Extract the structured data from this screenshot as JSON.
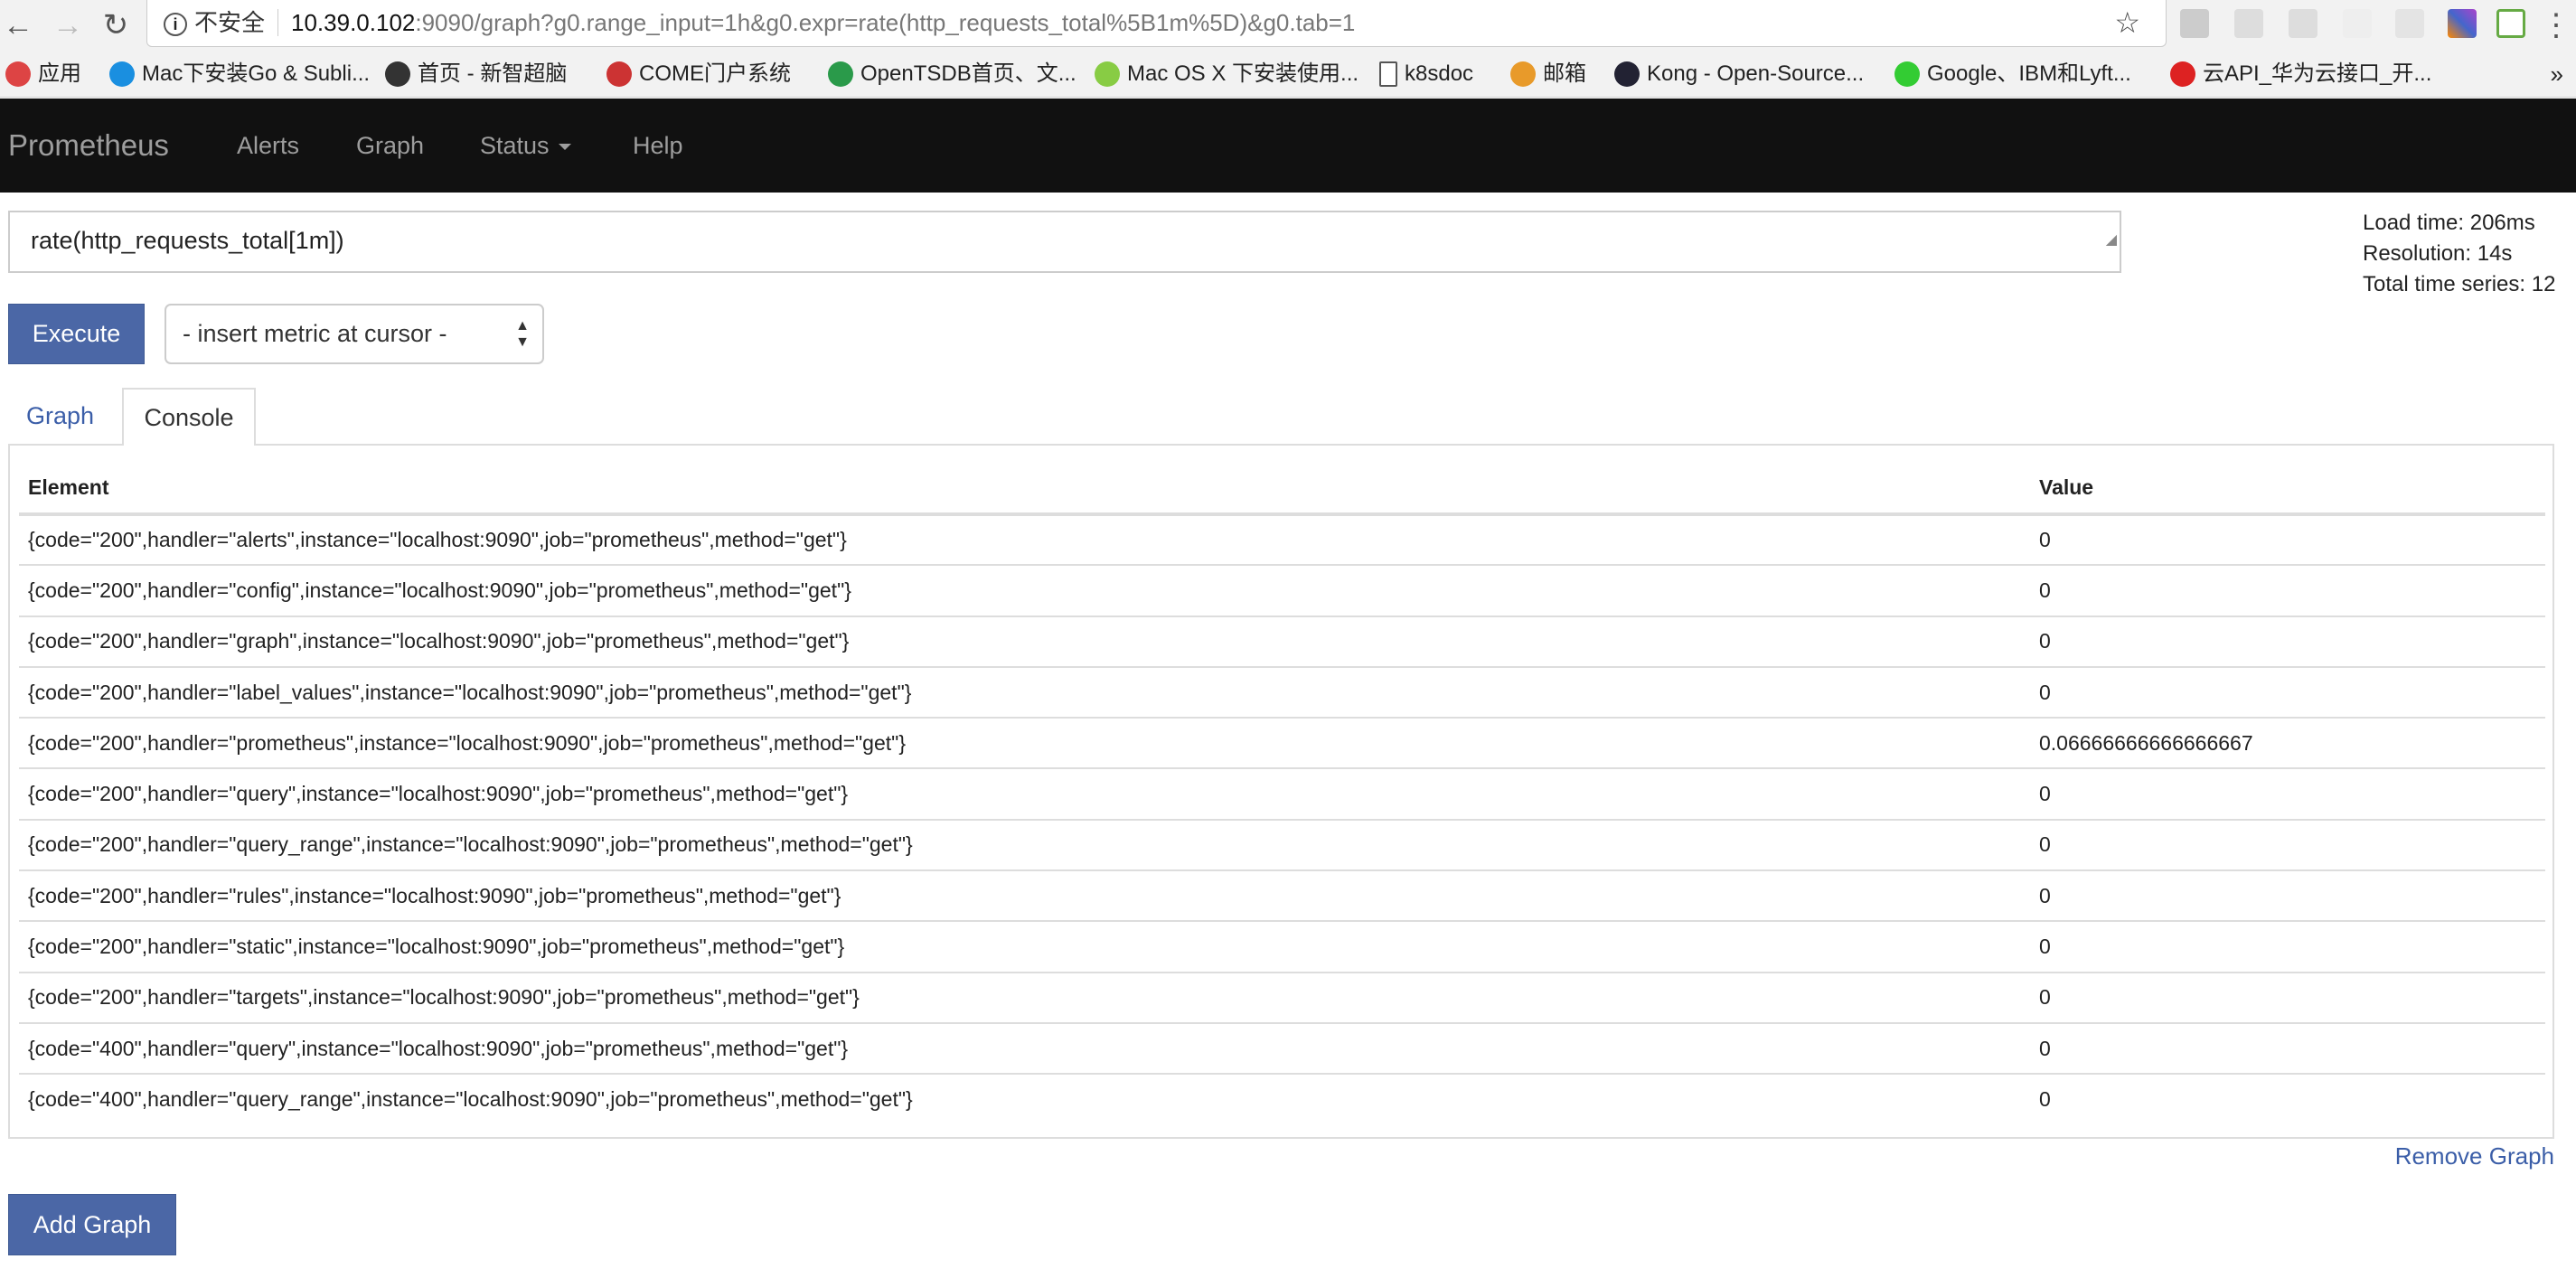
{
  "browser": {
    "security_label": "不安全",
    "url_host": "10.39.0.102",
    "url_path": ":9090/graph?g0.range_input=1h&g0.expr=rate(http_requests_total%5B1m%5D)&g0.tab=1",
    "bookmarks": [
      {
        "label": "应用",
        "icon": "apps-grid-icon",
        "color": "#d44"
      },
      {
        "label": "Mac下安装Go & Subli...",
        "icon": "c-logo-icon",
        "color": "#1a8fe0"
      },
      {
        "label": "首页 - 新智超脑",
        "icon": "edit-icon",
        "color": "#333"
      },
      {
        "label": "COME门户系统",
        "icon": "come-logo-icon",
        "color": "#c33"
      },
      {
        "label": "OpenTSDB首页、文...",
        "icon": "opentsdb-icon",
        "color": "#2a9a4a"
      },
      {
        "label": "Mac OS X 下安装使用...",
        "icon": "notepad-icon",
        "color": "#8c4"
      },
      {
        "label": "k8sdoc",
        "icon": "document-icon",
        "color": "#fff"
      },
      {
        "label": "邮箱",
        "icon": "mail-icon",
        "color": "#e89a2a"
      },
      {
        "label": "Kong - Open-Source...",
        "icon": "kong-gorilla-icon",
        "color": "#223"
      },
      {
        "label": "Google、IBM和Lyft...",
        "icon": "wechat-icon",
        "color": "#3c3"
      },
      {
        "label": "云API_华为云接口_开...",
        "icon": "huawei-icon",
        "color": "#d22"
      }
    ]
  },
  "navbar": {
    "brand": "Prometheus",
    "links": [
      "Alerts",
      "Graph",
      "Status",
      "Help"
    ]
  },
  "query": {
    "expression": "rate(http_requests_total[1m])",
    "execute_label": "Execute",
    "metric_select": "- insert metric at cursor -"
  },
  "stats": {
    "load_time": "Load time: 206ms",
    "resolution": "Resolution: 14s",
    "total_series": "Total time series: 12"
  },
  "tabs": [
    "Graph",
    "Console"
  ],
  "table": {
    "headers": [
      "Element",
      "Value"
    ],
    "rows": [
      [
        "{code=\"200\",handler=\"alerts\",instance=\"localhost:9090\",job=\"prometheus\",method=\"get\"}",
        "0"
      ],
      [
        "{code=\"200\",handler=\"config\",instance=\"localhost:9090\",job=\"prometheus\",method=\"get\"}",
        "0"
      ],
      [
        "{code=\"200\",handler=\"graph\",instance=\"localhost:9090\",job=\"prometheus\",method=\"get\"}",
        "0"
      ],
      [
        "{code=\"200\",handler=\"label_values\",instance=\"localhost:9090\",job=\"prometheus\",method=\"get\"}",
        "0"
      ],
      [
        "{code=\"200\",handler=\"prometheus\",instance=\"localhost:9090\",job=\"prometheus\",method=\"get\"}",
        "0.06666666666666667"
      ],
      [
        "{code=\"200\",handler=\"query\",instance=\"localhost:9090\",job=\"prometheus\",method=\"get\"}",
        "0"
      ],
      [
        "{code=\"200\",handler=\"query_range\",instance=\"localhost:9090\",job=\"prometheus\",method=\"get\"}",
        "0"
      ],
      [
        "{code=\"200\",handler=\"rules\",instance=\"localhost:9090\",job=\"prometheus\",method=\"get\"}",
        "0"
      ],
      [
        "{code=\"200\",handler=\"static\",instance=\"localhost:9090\",job=\"prometheus\",method=\"get\"}",
        "0"
      ],
      [
        "{code=\"200\",handler=\"targets\",instance=\"localhost:9090\",job=\"prometheus\",method=\"get\"}",
        "0"
      ],
      [
        "{code=\"400\",handler=\"query\",instance=\"localhost:9090\",job=\"prometheus\",method=\"get\"}",
        "0"
      ],
      [
        "{code=\"400\",handler=\"query_range\",instance=\"localhost:9090\",job=\"prometheus\",method=\"get\"}",
        "0"
      ]
    ]
  },
  "remove_graph_label": "Remove Graph",
  "add_graph_label": "Add Graph",
  "colors": {
    "navbar": "#111111",
    "primary": "#4b67a6",
    "link": "#3b5ea8"
  }
}
